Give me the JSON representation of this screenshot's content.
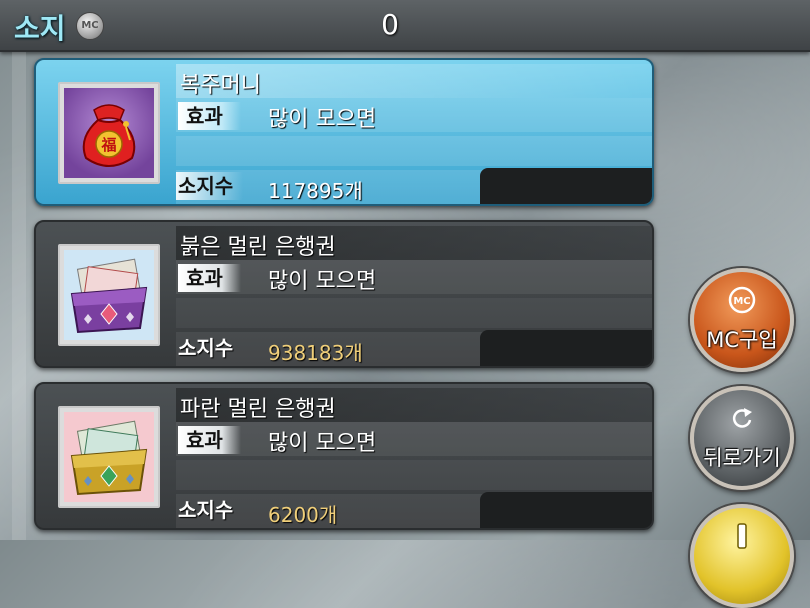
{
  "header": {
    "title": "소지",
    "coin_label": "MC",
    "balance": "0"
  },
  "items": [
    {
      "name": "복주머니",
      "effect_tag": "효과",
      "effect": "많이 모으면",
      "count_tag": "소지수",
      "count": "117895개",
      "icon": "lucky-pouch-icon",
      "selected": true
    },
    {
      "name": "붉은 멀린 은행권",
      "effect_tag": "효과",
      "effect": "많이 모으면",
      "count_tag": "소지수",
      "count": "938183개",
      "icon": "red-banknote-wallet-icon",
      "selected": false
    },
    {
      "name": "파란 멀린 은행권",
      "effect_tag": "효과",
      "effect": "많이 모으면",
      "count_tag": "소지수",
      "count": "6200개",
      "icon": "blue-banknote-wallet-icon",
      "selected": false
    }
  ],
  "side_buttons": {
    "mc_coin_label": "MC",
    "mc_purchase": "MC구입",
    "back": "뒤로가기"
  },
  "colors": {
    "accent_cyan": "#9fe8f5",
    "count_gold": "#f0cf7a",
    "selected_card": "#3aa4cf",
    "mc_button": "#c9561b"
  }
}
